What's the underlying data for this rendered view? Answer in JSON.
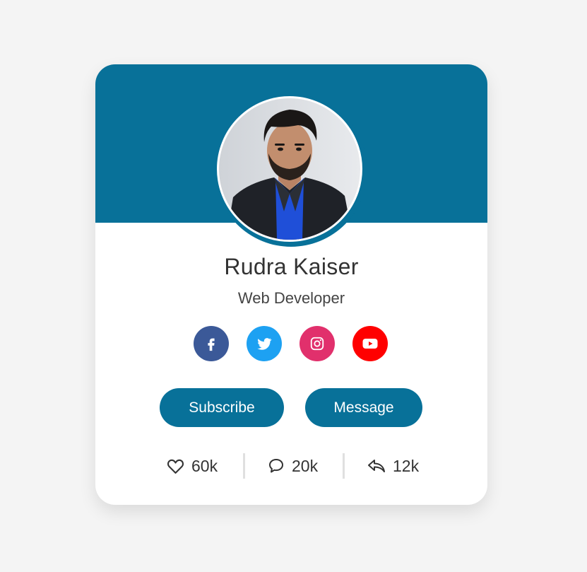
{
  "profile": {
    "name": "Rudra Kaiser",
    "title": "Web Developer"
  },
  "socials": [
    {
      "name": "facebook",
      "icon": "facebook-icon",
      "color": "#3b5998"
    },
    {
      "name": "twitter",
      "icon": "twitter-icon",
      "color": "#1da1f2"
    },
    {
      "name": "instagram",
      "icon": "instagram-icon",
      "color": "#e1306c"
    },
    {
      "name": "youtube",
      "icon": "youtube-icon",
      "color": "#ff0000"
    }
  ],
  "buttons": {
    "subscribe": "Subscribe",
    "message": "Message"
  },
  "stats": {
    "likes": "60k",
    "comments": "20k",
    "shares": "12k"
  },
  "colors": {
    "accent": "#087199",
    "background": "#f4f4f4"
  }
}
